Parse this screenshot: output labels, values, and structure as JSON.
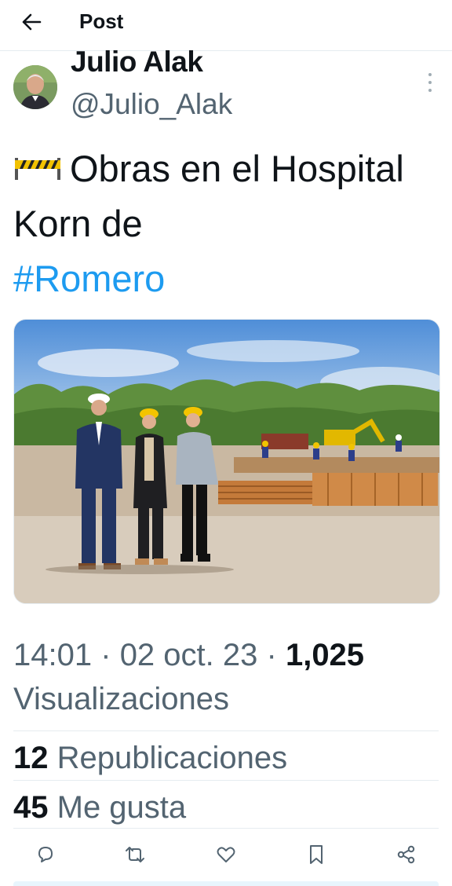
{
  "header": {
    "title": "Post",
    "back_icon": "arrow-left-icon"
  },
  "author": {
    "name": "Julio Alak",
    "handle": "@Julio_Alak"
  },
  "tweet": {
    "emoji": "construction-barrier-emoji",
    "text": "Obras en el Hospital Korn de",
    "hashtag": "#Romero"
  },
  "photo": {
    "description_icon": "construction-site-photo"
  },
  "meta": {
    "time": "14:01",
    "date": "02 oct. 23",
    "separator": "·",
    "views_count": "1,025",
    "views_label": "Visualizaciones"
  },
  "stats": {
    "reposts_count": "12",
    "reposts_label": "Republicaciones",
    "likes_count": "45",
    "likes_label": "Me gusta"
  },
  "colors": {
    "accent": "#1d9bf0",
    "text": "#0f1419",
    "muted": "#536471",
    "divider": "#e6ecf0"
  }
}
